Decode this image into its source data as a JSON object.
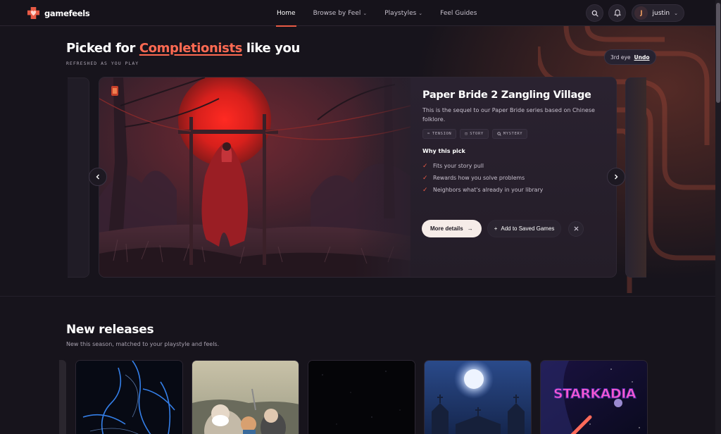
{
  "brand": {
    "part1": "game",
    "part2": "feels"
  },
  "nav": {
    "items": [
      {
        "label": "Home",
        "active": true,
        "dropdown": false
      },
      {
        "label": "Browse by Feel",
        "active": false,
        "dropdown": true
      },
      {
        "label": "Playstyles",
        "active": false,
        "dropdown": true
      },
      {
        "label": "Feel Guides",
        "active": false,
        "dropdown": false
      }
    ],
    "user": {
      "initial": "J",
      "name": "justin"
    }
  },
  "picked": {
    "title_prefix": "Picked for ",
    "title_accent": "Completionists",
    "title_suffix": " like you",
    "subtitle": "REFRESHED AS YOU PLAY",
    "undo": {
      "label": "3rd eye",
      "action": "Undo"
    }
  },
  "hero": {
    "title": "Paper Bride 2 Zangling Village",
    "description": "This is the sequel to our Paper Bride series based on Chinese folklore.",
    "tags": [
      "TENSION",
      "STORY",
      "MYSTERY"
    ],
    "why_title": "Why this pick",
    "reasons": [
      "Fits your story pull",
      "Rewards how you solve problems",
      "Neighbors what's already in your library"
    ],
    "more_label": "More details",
    "save_label": "Add to Saved Games"
  },
  "new_releases": {
    "title": "New releases",
    "subtitle": "New this season, matched to your playstyle and feels.",
    "cards": [
      {
        "name": "blue-neon-sketch"
      },
      {
        "name": "cartoon-townsfolk"
      },
      {
        "name": "dark-starfield"
      },
      {
        "name": "moonlit-church"
      },
      {
        "name": "starkadia",
        "logo_text": "STARKADIA"
      }
    ]
  },
  "colors": {
    "accent": "#e85a45",
    "accent_text": "#ff6a52",
    "background": "#17141c"
  }
}
